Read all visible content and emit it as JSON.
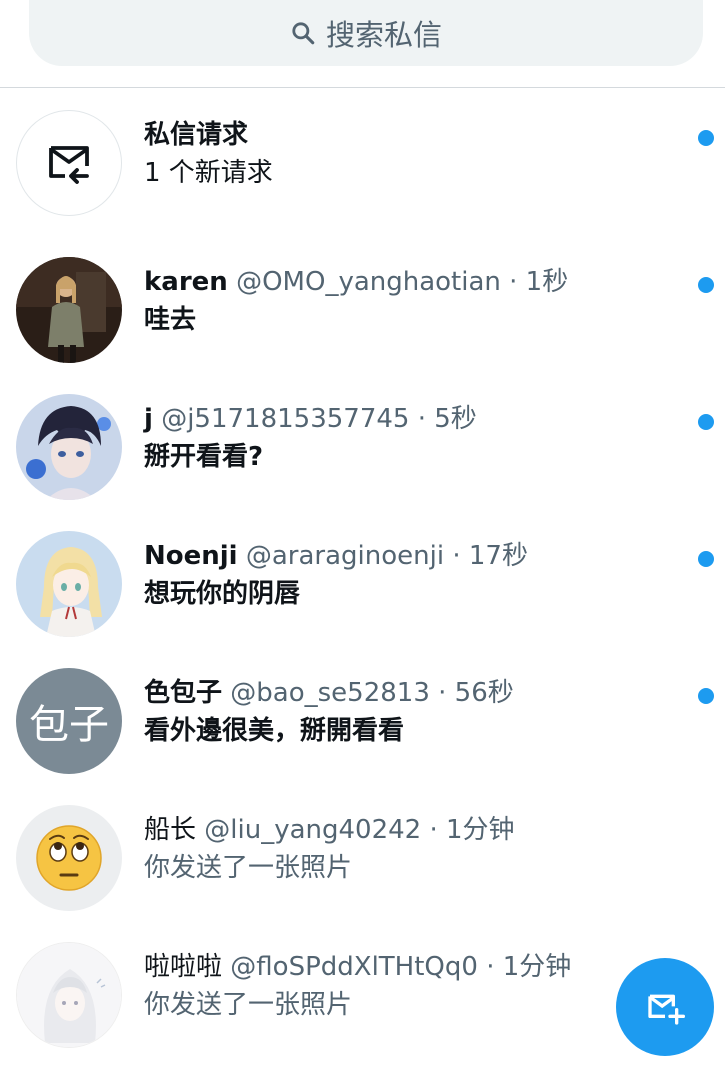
{
  "search": {
    "placeholder": "搜索私信"
  },
  "request": {
    "title": "私信请求",
    "subtitle": "1 个新请求"
  },
  "conversations": [
    {
      "name": "karen",
      "handle": "@OMO_yanghaotian",
      "time": "· 1秒",
      "message": "哇去",
      "unread": true,
      "avatar_icon": "user-avatar-photo"
    },
    {
      "name": "j",
      "handle": "@j5171815357745",
      "time": "· 5秒",
      "message": "掰开看看?",
      "unread": true,
      "avatar_icon": "user-avatar-photo"
    },
    {
      "name": "Noenji",
      "handle": "@araraginoenji",
      "time": "· 17秒",
      "message": "想玩你的阴唇",
      "unread": true,
      "avatar_icon": "user-avatar-photo"
    },
    {
      "name": "色包子",
      "handle": "@bao_se52813",
      "time": "· 56秒",
      "message": "看外邊很美，掰開看看",
      "unread": true,
      "avatar_text": "包子"
    },
    {
      "name": "船长",
      "handle": "@liu_yang40242",
      "time": "· 1分钟",
      "message": "你发送了一张照片",
      "unread": false,
      "avatar_icon": "eye-roll-emoji"
    },
    {
      "name": "啦啦啦",
      "handle": "@floSPddXlTHtQq0",
      "time": "· 1分钟",
      "message": "你发送了一张照片",
      "unread": false,
      "avatar_icon": "user-avatar-photo"
    }
  ],
  "colors": {
    "accent": "#1d9bf0",
    "text": "#0f1419",
    "secondary": "#536471"
  },
  "fab": {
    "icon": "new-message-icon"
  }
}
